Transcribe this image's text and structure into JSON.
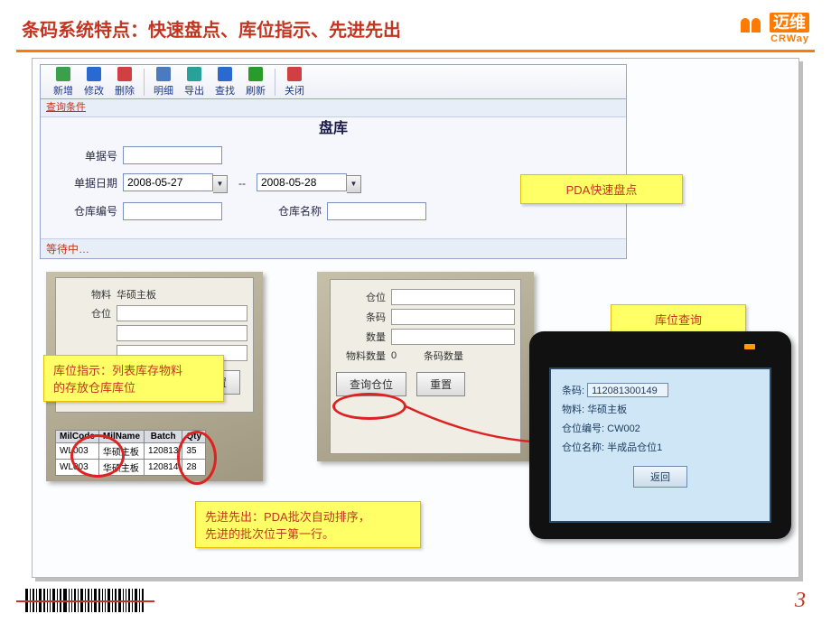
{
  "header": {
    "title": "条码系统特点：快速盘点、库位指示、先进先出",
    "logo_cn": "迈维",
    "logo_en": "CRWay"
  },
  "toolbar": {
    "items": [
      {
        "label": "新增",
        "icon": "#3aa04a"
      },
      {
        "label": "修改",
        "icon": "#2a6ad0"
      },
      {
        "label": "删除",
        "icon": "#d04040"
      },
      {
        "label": "明细",
        "icon": "#4a7ac0"
      },
      {
        "label": "导出",
        "icon": "#2aa09a"
      },
      {
        "label": "查找",
        "icon": "#2a6ad0"
      },
      {
        "label": "刷新",
        "icon": "#2a9a2a"
      },
      {
        "label": "关闭",
        "icon": "#d04040"
      }
    ]
  },
  "query_bar": "查询条件",
  "form": {
    "caption": "盘库",
    "order_label": "单据号",
    "date_label": "单据日期",
    "date_from": "2008-05-27",
    "date_to": "2008-05-28",
    "whcode_label": "仓库编号",
    "whname_label": "仓库名称",
    "wait_text": "等待中…"
  },
  "callouts": {
    "c1": "PDA快速盘点",
    "c2": "库位查询",
    "c3_l1": "库位指示：列表库存物料",
    "c3_l2": "的存放仓库库位",
    "c4_l1": "先进先出：PDA批次自动排序，",
    "c4_l2": "先进的批次位于第一行。"
  },
  "pda_left": {
    "material_label": "物料",
    "material_value": "华硕主板",
    "loc_label": "仓位",
    "reset_btn": "重置",
    "table": {
      "headers": [
        "MilCode",
        "MilName",
        "Batch",
        "Qty"
      ],
      "rows": [
        [
          "WL003",
          "华硕主板",
          "120813",
          "35"
        ],
        [
          "WL003",
          "华硕主板",
          "120814",
          "28"
        ]
      ]
    }
  },
  "pda_mid": {
    "loc_label": "仓位",
    "barcode_label": "条码",
    "qty_label": "数量",
    "matqty_label": "物料数量",
    "matqty_val": "0",
    "bcqty_label": "条码数量",
    "query_btn": "查询仓位",
    "reset_btn": "重置"
  },
  "pda_right": {
    "barcode_label": "条码:",
    "barcode_value": "112081300149",
    "material_label": "物料:",
    "material_value": "华硕主板",
    "loccode_label": "仓位编号:",
    "loccode_value": "CW002",
    "locname_label": "仓位名称:",
    "locname_value": "半成品仓位1",
    "back_btn": "返回"
  },
  "footer": {
    "page": "3"
  }
}
